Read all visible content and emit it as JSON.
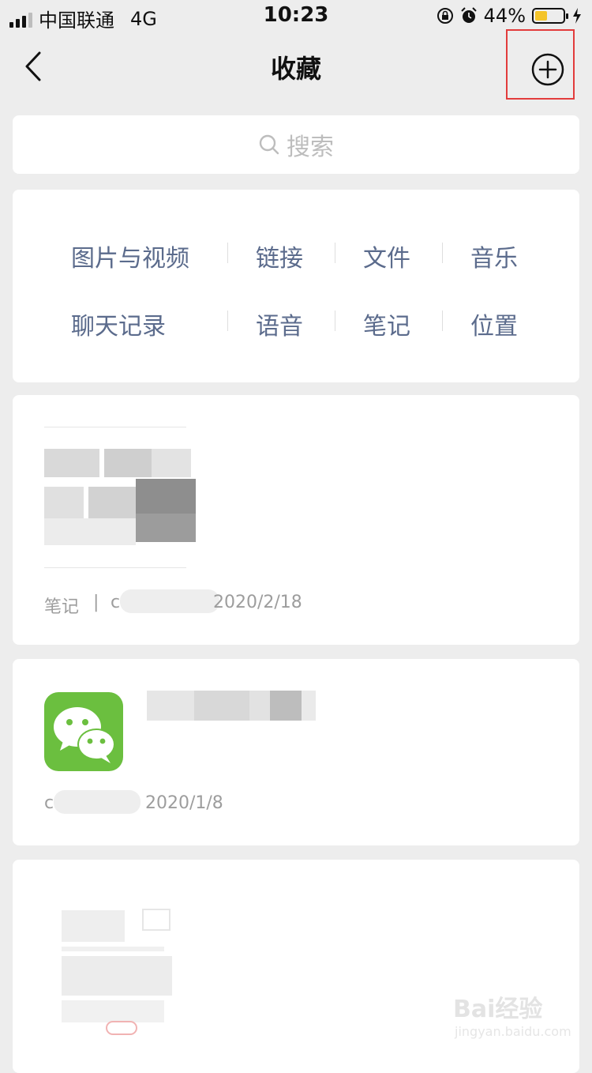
{
  "status_bar": {
    "carrier": "中国联通",
    "network": "4G",
    "time": "10:23",
    "battery_percent": "44%",
    "battery_level": 0.44
  },
  "nav": {
    "title": "收藏"
  },
  "search": {
    "placeholder": "搜索"
  },
  "categories": [
    {
      "label": "图片与视频"
    },
    {
      "label": "链接"
    },
    {
      "label": "文件"
    },
    {
      "label": "音乐"
    },
    {
      "label": "聊天记录"
    },
    {
      "label": "语音"
    },
    {
      "label": "笔记"
    },
    {
      "label": "位置"
    }
  ],
  "items": [
    {
      "type": "笔记",
      "separator": "|",
      "source_prefix": "c",
      "date": "2020/2/18"
    },
    {
      "source_prefix": "c",
      "date": "2020/1/8",
      "icon": "wechat-icon"
    },
    {}
  ],
  "watermark": {
    "text": "Bai经验",
    "sub": "jingyan.baidu.com"
  },
  "colors": {
    "background": "#ededed",
    "category_text": "#5b6b8c",
    "meta_text": "#9d9d9d",
    "highlight": "#e23c3c",
    "wechat_green": "#6bbf3f"
  }
}
